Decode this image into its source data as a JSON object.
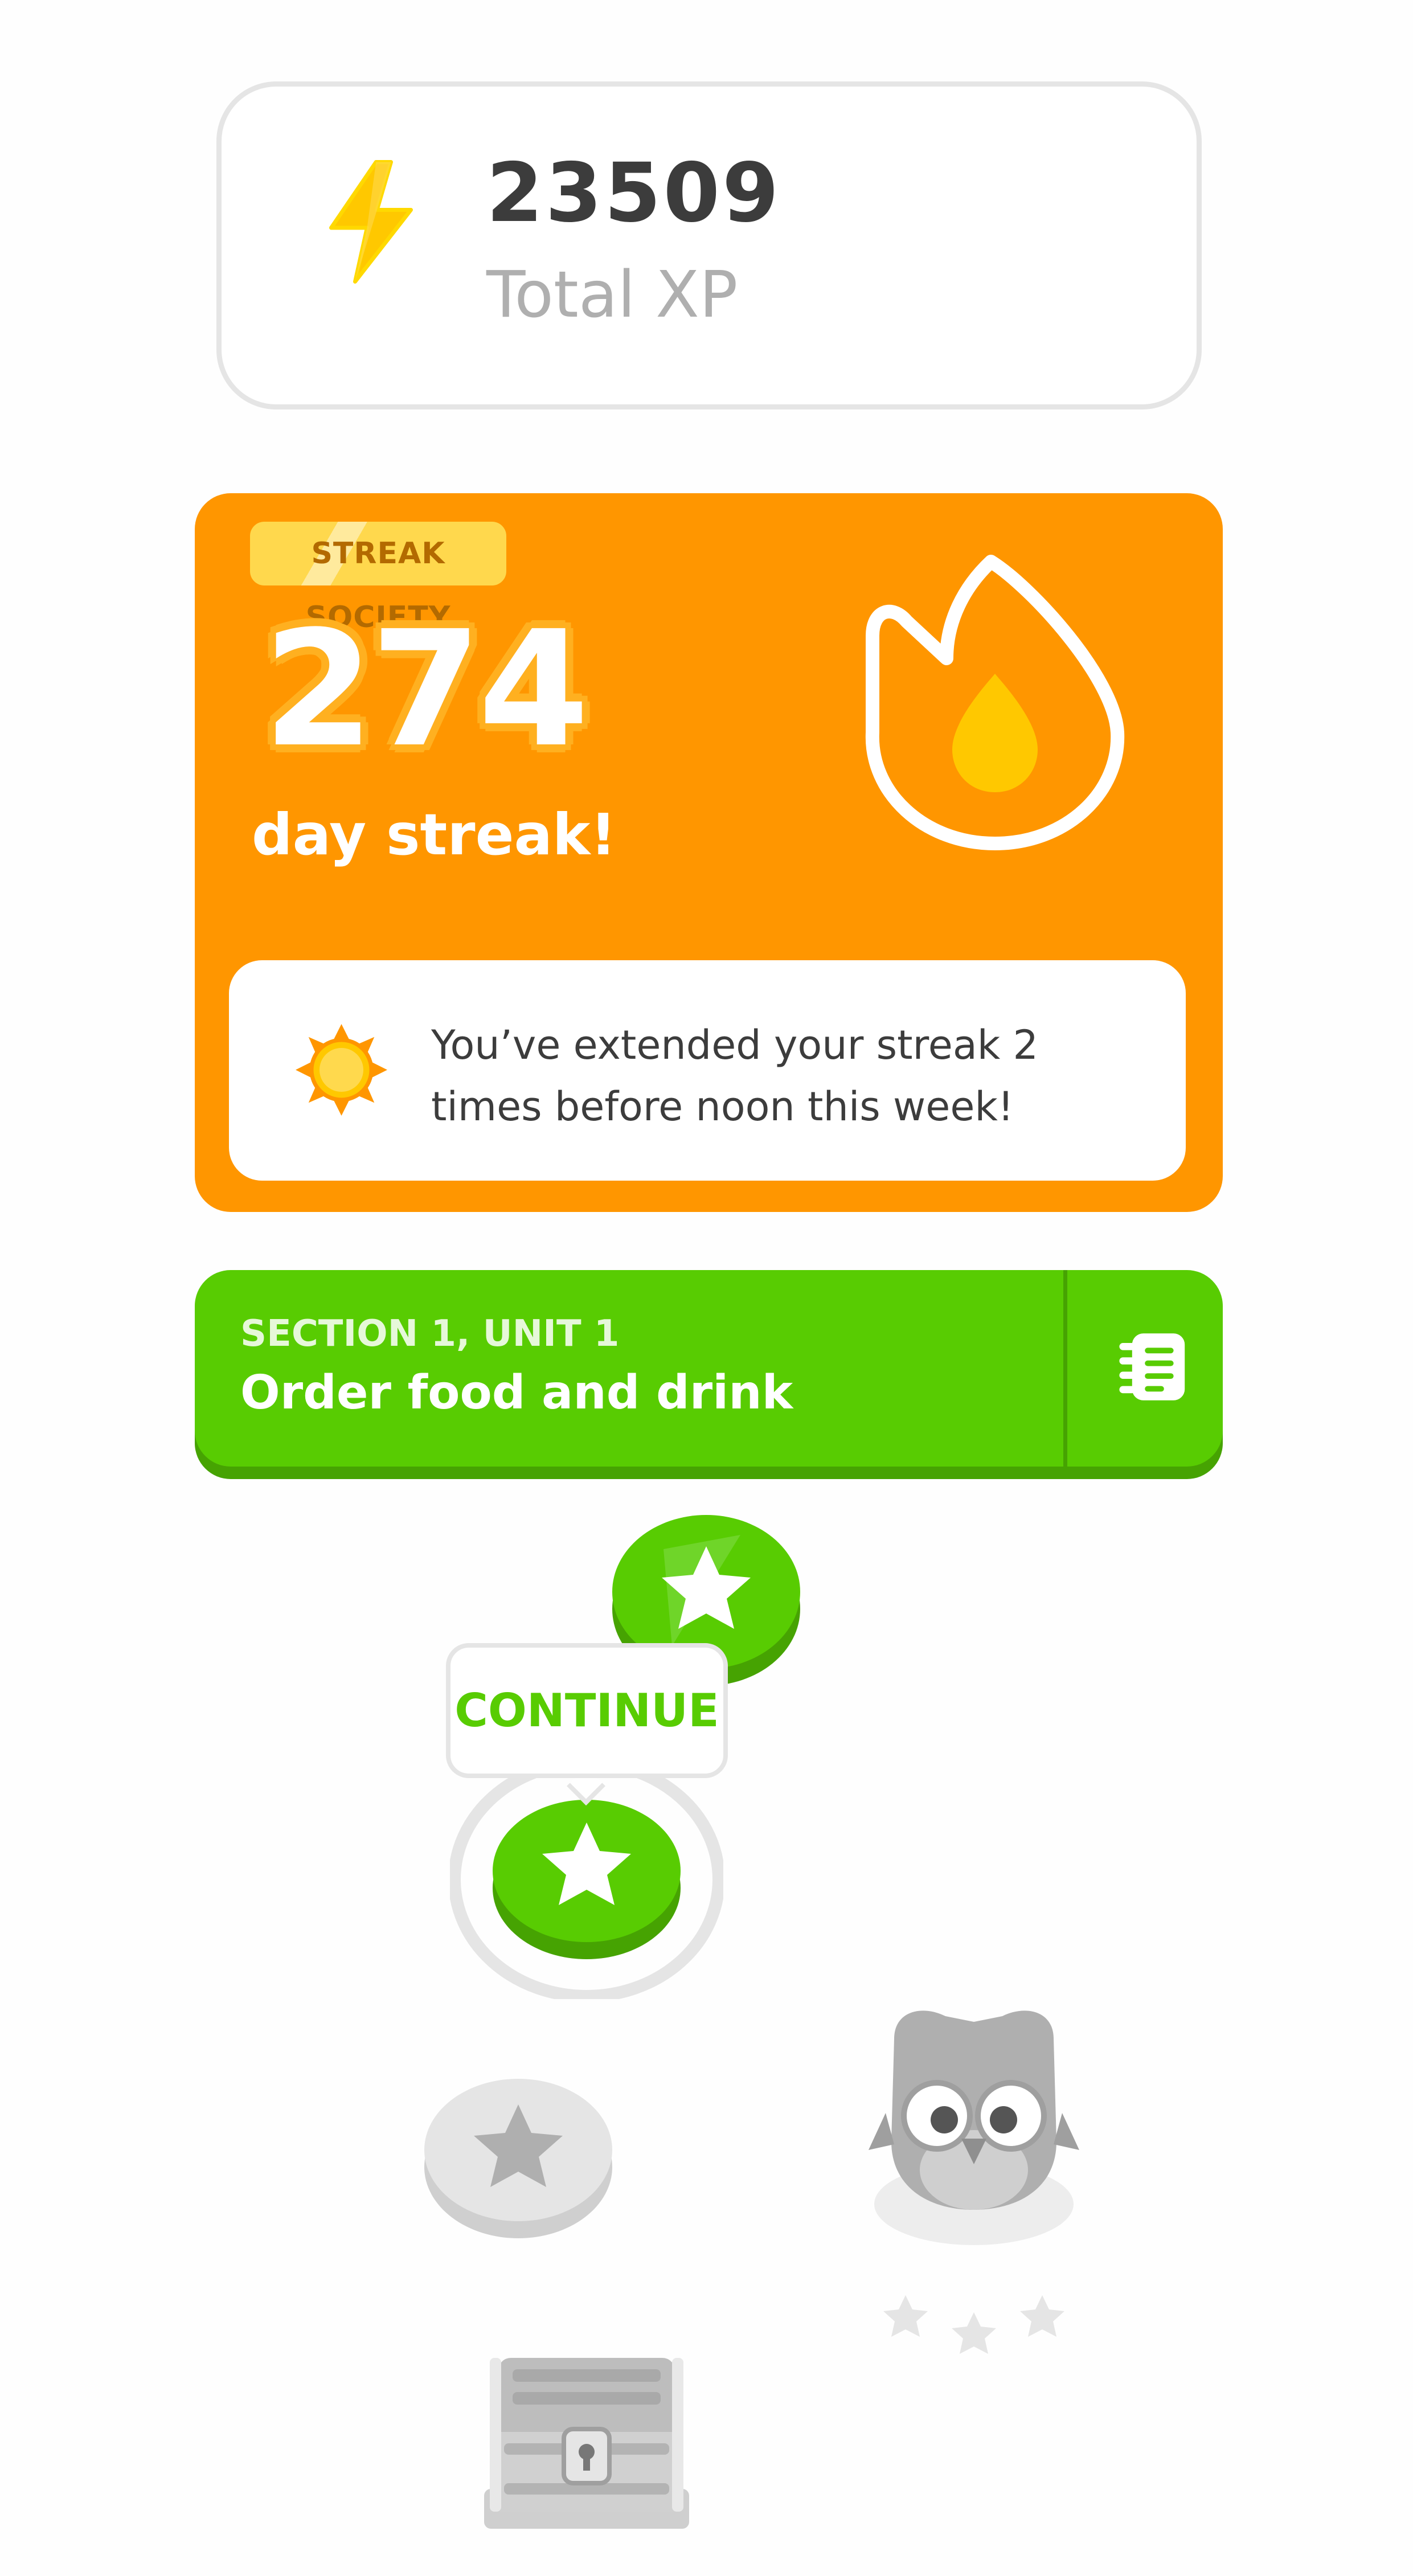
{
  "xp": {
    "value": "23509",
    "label": "Total XP",
    "icon": "lightning-bolt-icon"
  },
  "streak": {
    "badge": "STREAK SOCIETY",
    "count": "274",
    "label": "day streak!",
    "icon": "flame-icon",
    "note": "You’ve extended your streak 2 times before noon this week!",
    "note_icon": "sun-icon"
  },
  "unit": {
    "section": "SECTION 1, UNIT 1",
    "title": "Order food and drink",
    "guide_icon": "guidebook-icon"
  },
  "path": {
    "continue_label": "CONTINUE",
    "nodes": [
      {
        "type": "lesson",
        "state": "completed"
      },
      {
        "type": "lesson",
        "state": "current"
      },
      {
        "type": "lesson",
        "state": "locked"
      },
      {
        "type": "character",
        "state": "locked"
      },
      {
        "type": "chest",
        "state": "locked"
      }
    ]
  },
  "colors": {
    "green": "#58cc02",
    "green_dark": "#46a302",
    "orange": "#ff9600",
    "yellow": "#ffc800",
    "locked_gray": "#e5e5e5",
    "text_dark": "#3c3c3c",
    "text_muted": "#afafaf"
  }
}
